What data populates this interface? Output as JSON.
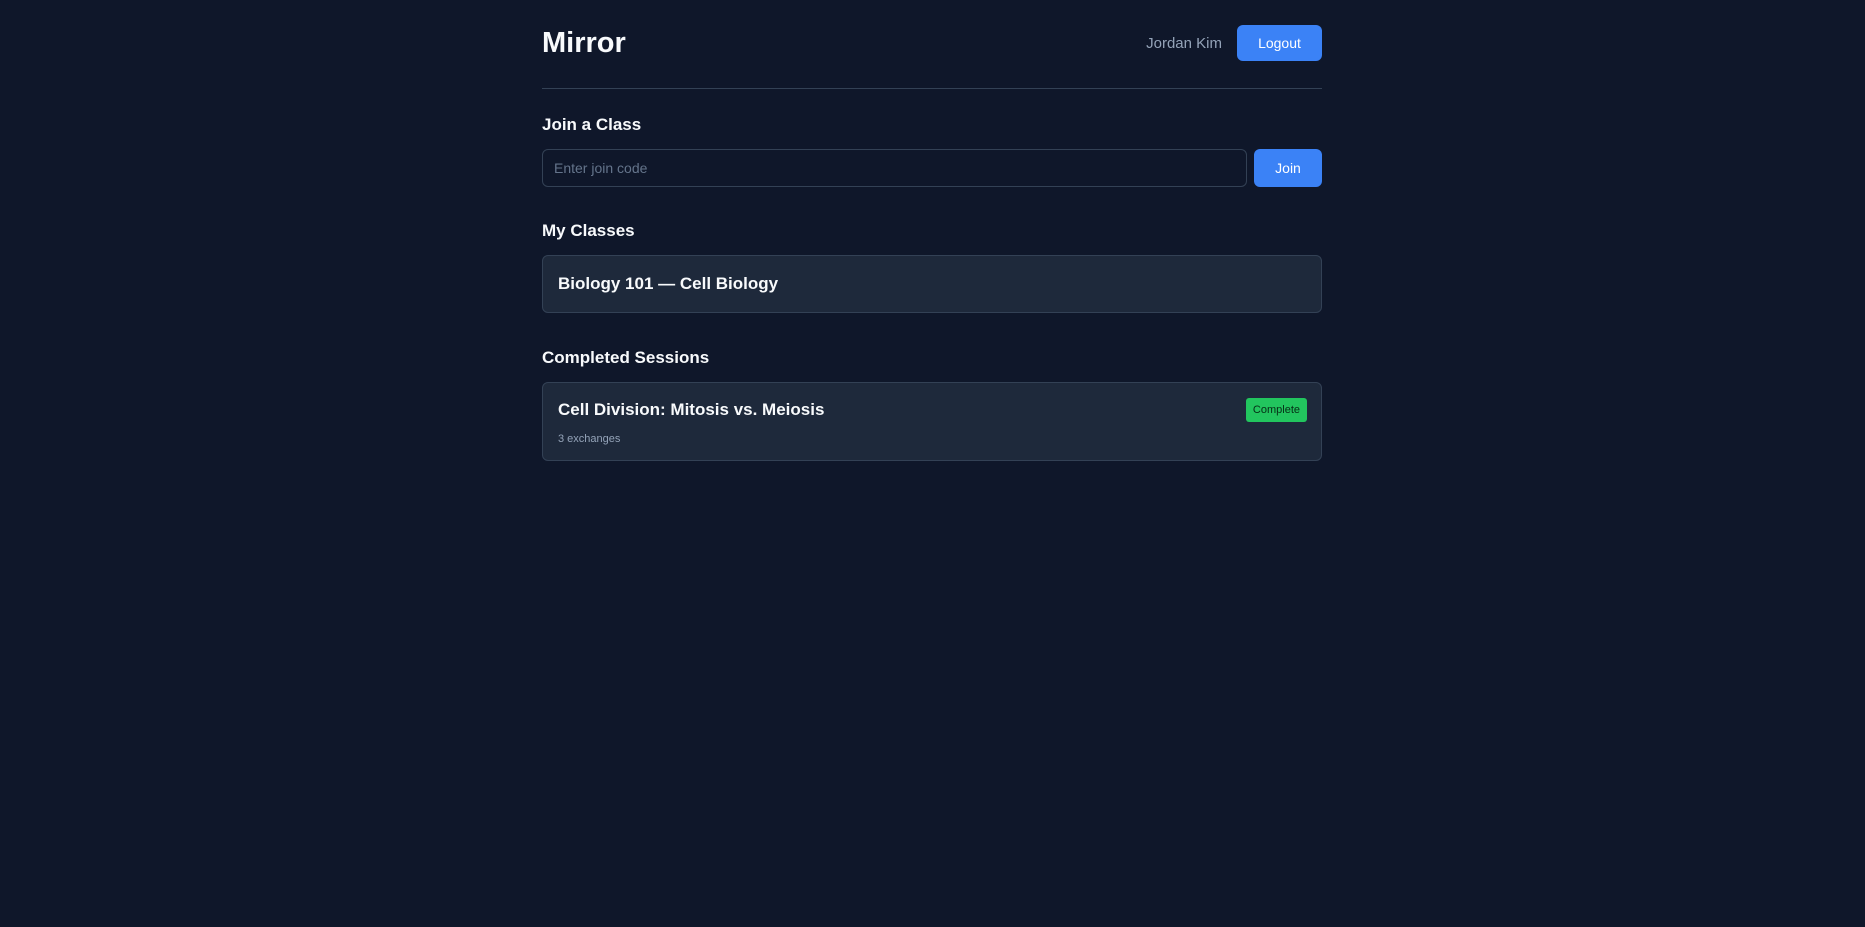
{
  "header": {
    "title": "Mirror",
    "user_name": "Jordan Kim",
    "logout_label": "Logout"
  },
  "join": {
    "heading": "Join a Class",
    "placeholder": "Enter join code",
    "value": "",
    "button_label": "Join"
  },
  "classes": {
    "heading": "My Classes",
    "items": [
      {
        "name": "Biology 101 — Cell Biology"
      }
    ]
  },
  "sessions": {
    "heading": "Completed Sessions",
    "items": [
      {
        "title": "Cell Division: Mitosis vs. Meiosis",
        "meta": "3 exchanges",
        "status": "Complete"
      }
    ]
  },
  "colors": {
    "background": "#0f172a",
    "card": "#1e293b",
    "accent": "#3b82f6",
    "status_complete": "#22c55e"
  }
}
